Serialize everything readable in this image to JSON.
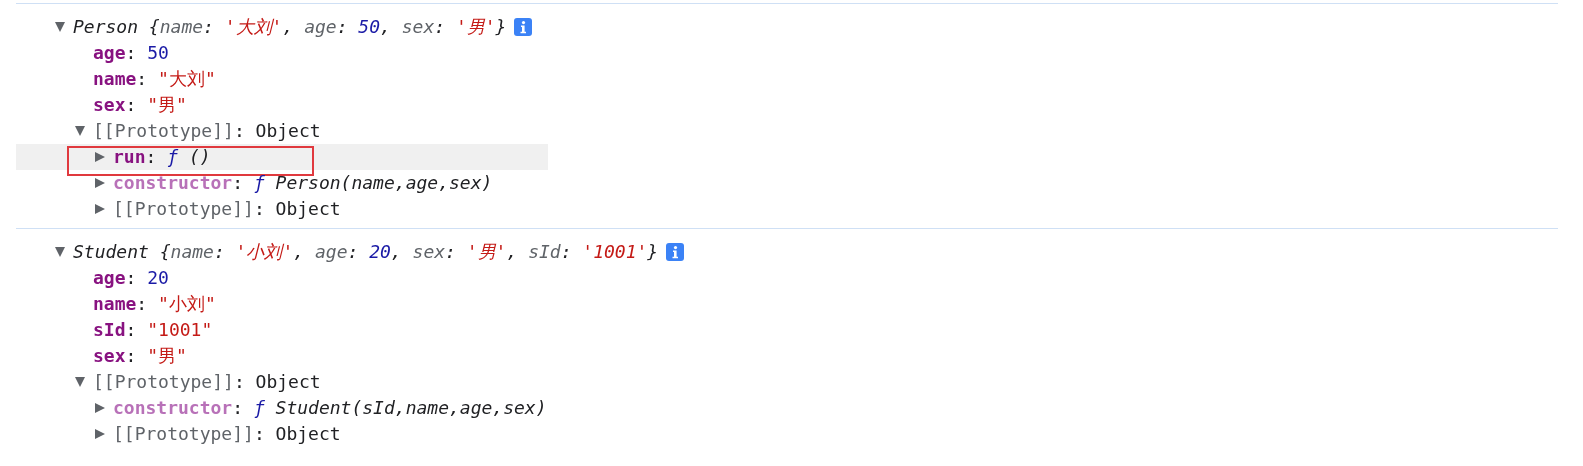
{
  "entries": [
    {
      "expanded": true,
      "segments": [
        {
          "text": "Person",
          "kind": "class"
        },
        {
          "text": " {",
          "kind": "punct"
        },
        {
          "text": "name",
          "kind": "pkey"
        },
        {
          "text": ": ",
          "kind": "punct"
        },
        {
          "text": "'大刘'",
          "kind": "str"
        },
        {
          "text": ", ",
          "kind": "punct"
        },
        {
          "text": "age",
          "kind": "pkey"
        },
        {
          "text": ": ",
          "kind": "punct"
        },
        {
          "text": "50",
          "kind": "num"
        },
        {
          "text": ", ",
          "kind": "punct"
        },
        {
          "text": "sex",
          "kind": "pkey"
        },
        {
          "text": ": ",
          "kind": "punct"
        },
        {
          "text": "'男'",
          "kind": "str"
        },
        {
          "text": "}",
          "kind": "punct"
        }
      ],
      "children": [
        {
          "highlighted": false,
          "segments": [
            {
              "text": "age",
              "kind": "key"
            },
            {
              "text": ": ",
              "kind": "plain"
            },
            {
              "text": "50",
              "kind": "num"
            }
          ]
        },
        {
          "highlighted": false,
          "segments": [
            {
              "text": "name",
              "kind": "key"
            },
            {
              "text": ": ",
              "kind": "plain"
            },
            {
              "text": "\"大刘\"",
              "kind": "str"
            }
          ]
        },
        {
          "highlighted": false,
          "segments": [
            {
              "text": "sex",
              "kind": "key"
            },
            {
              "text": ": ",
              "kind": "plain"
            },
            {
              "text": "\"男\"",
              "kind": "str"
            }
          ]
        },
        {
          "highlighted": false,
          "expanded": true,
          "segments": [
            {
              "text": "[[Prototype]]",
              "kind": "internal"
            },
            {
              "text": ": Object",
              "kind": "plain"
            }
          ],
          "children": [
            {
              "highlighted": true,
              "expanded": false,
              "segments": [
                {
                  "text": "run",
                  "kind": "key"
                },
                {
                  "text": ": ",
                  "kind": "plain"
                },
                {
                  "text": "ƒ",
                  "kind": "fn"
                },
                {
                  "text": " ()",
                  "kind": "sig"
                }
              ]
            },
            {
              "highlighted": false,
              "expanded": false,
              "segments": [
                {
                  "text": "constructor",
                  "kind": "keydim"
                },
                {
                  "text": ": ",
                  "kind": "plain"
                },
                {
                  "text": "ƒ",
                  "kind": "fn"
                },
                {
                  "text": " Person(name,age,sex)",
                  "kind": "sig"
                }
              ]
            },
            {
              "highlighted": false,
              "expanded": false,
              "segments": [
                {
                  "text": "[[Prototype]]",
                  "kind": "internal"
                },
                {
                  "text": ": Object",
                  "kind": "plain"
                }
              ]
            }
          ]
        }
      ]
    },
    {
      "expanded": true,
      "segments": [
        {
          "text": "Student",
          "kind": "class"
        },
        {
          "text": " {",
          "kind": "punct"
        },
        {
          "text": "name",
          "kind": "pkey"
        },
        {
          "text": ": ",
          "kind": "punct"
        },
        {
          "text": "'小刘'",
          "kind": "str"
        },
        {
          "text": ", ",
          "kind": "punct"
        },
        {
          "text": "age",
          "kind": "pkey"
        },
        {
          "text": ": ",
          "kind": "punct"
        },
        {
          "text": "20",
          "kind": "num"
        },
        {
          "text": ", ",
          "kind": "punct"
        },
        {
          "text": "sex",
          "kind": "pkey"
        },
        {
          "text": ": ",
          "kind": "punct"
        },
        {
          "text": "'男'",
          "kind": "str"
        },
        {
          "text": ", ",
          "kind": "punct"
        },
        {
          "text": "sId",
          "kind": "pkey"
        },
        {
          "text": ": ",
          "kind": "punct"
        },
        {
          "text": "'1001'",
          "kind": "str"
        },
        {
          "text": "}",
          "kind": "punct"
        }
      ],
      "children": [
        {
          "highlighted": false,
          "segments": [
            {
              "text": "age",
              "kind": "key"
            },
            {
              "text": ": ",
              "kind": "plain"
            },
            {
              "text": "20",
              "kind": "num"
            }
          ]
        },
        {
          "highlighted": false,
          "segments": [
            {
              "text": "name",
              "kind": "key"
            },
            {
              "text": ": ",
              "kind": "plain"
            },
            {
              "text": "\"小刘\"",
              "kind": "str"
            }
          ]
        },
        {
          "highlighted": false,
          "segments": [
            {
              "text": "sId",
              "kind": "key"
            },
            {
              "text": ": ",
              "kind": "plain"
            },
            {
              "text": "\"1001\"",
              "kind": "str"
            }
          ]
        },
        {
          "highlighted": false,
          "segments": [
            {
              "text": "sex",
              "kind": "key"
            },
            {
              "text": ": ",
              "kind": "plain"
            },
            {
              "text": "\"男\"",
              "kind": "str"
            }
          ]
        },
        {
          "highlighted": false,
          "expanded": true,
          "segments": [
            {
              "text": "[[Prototype]]",
              "kind": "internal"
            },
            {
              "text": ": Object",
              "kind": "plain"
            }
          ],
          "children": [
            {
              "highlighted": false,
              "expanded": false,
              "segments": [
                {
                  "text": "constructor",
                  "kind": "keydim"
                },
                {
                  "text": ": ",
                  "kind": "plain"
                },
                {
                  "text": "ƒ",
                  "kind": "fn"
                },
                {
                  "text": " Student(sId,name,age,sex)",
                  "kind": "sig"
                }
              ]
            },
            {
              "highlighted": false,
              "expanded": false,
              "segments": [
                {
                  "text": "[[Prototype]]",
                  "kind": "internal"
                },
                {
                  "text": ": Object",
                  "kind": "plain"
                }
              ]
            }
          ]
        }
      ]
    }
  ]
}
